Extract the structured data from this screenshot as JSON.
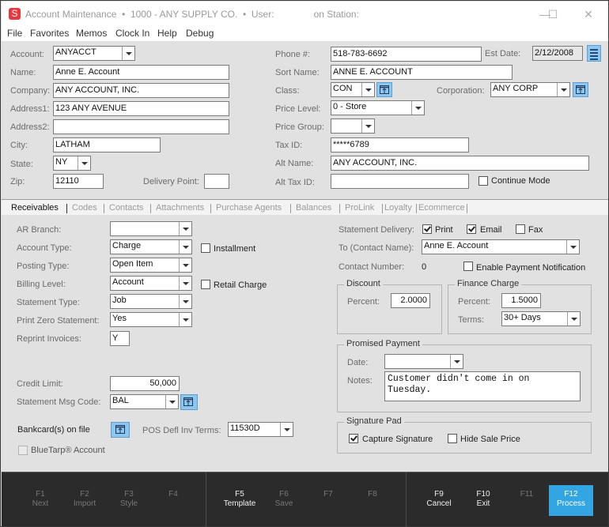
{
  "window": {
    "app_icon_letter": "S",
    "title": "Account Maintenance  •  1000 - ANY SUPPLY CO.  •  User:               on Station:",
    "controls": {
      "minimize": "—",
      "maximize": "☐",
      "close": "✕"
    }
  },
  "menu": [
    "File",
    "Favorites",
    "Memos",
    "Clock In",
    "Help",
    "Debug"
  ],
  "header": {
    "account_label": "Account:",
    "account_value": "ANYACCT",
    "name_label": "Name:",
    "name_value": "Anne E. Account",
    "company_label": "Company:",
    "company_value": "ANY ACCOUNT, INC.",
    "address1_label": "Address1:",
    "address1_value": "123 ANY AVENUE",
    "address2_label": "Address2:",
    "address2_value": "",
    "city_label": "City:",
    "city_value": "LATHAM",
    "state_label": "State:",
    "state_value": "NY",
    "zip_label": "Zip:",
    "zip_value": "12110",
    "delivery_point_label": "Delivery Point:",
    "delivery_point_value": "",
    "phone_label": "Phone #:",
    "phone_value": "518-783-6692",
    "est_date_label": "Est Date:",
    "est_date_value": "2/12/2008",
    "sort_name_label": "Sort Name:",
    "sort_name_value": "ANNE E. ACCOUNT",
    "class_label": "Class:",
    "class_value": "CON",
    "corporation_label": "Corporation:",
    "corporation_value": "ANY CORP",
    "price_level_label": "Price Level:",
    "price_level_value": "0 - Store",
    "price_group_label": "Price Group:",
    "price_group_value": "",
    "tax_id_label": "Tax ID:",
    "tax_id_value": "*****6789",
    "alt_name_label": "Alt  Name:",
    "alt_name_value": "ANY ACCOUNT, INC.",
    "alt_tax_id_label": "Alt Tax ID:",
    "alt_tax_id_value": "",
    "continue_mode_label": "Continue Mode",
    "continue_mode_checked": false
  },
  "tabs": [
    {
      "label": "Receivables",
      "active": true
    },
    {
      "label": "Codes",
      "active": false
    },
    {
      "label": "Contacts",
      "active": false
    },
    {
      "label": "Attachments",
      "active": false
    },
    {
      "label": "Purchase Agents",
      "active": false
    },
    {
      "label": "Balances",
      "active": false
    },
    {
      "label": "ProLink",
      "active": false
    },
    {
      "label": "Loyalty",
      "active": false
    },
    {
      "label": "Ecommerce",
      "active": false
    }
  ],
  "receivables": {
    "ar_branch_label": "AR Branch:",
    "ar_branch_value": "",
    "account_type_label": "Account Type:",
    "account_type_value": "Charge",
    "installment_label": "Installment",
    "installment_checked": false,
    "posting_type_label": "Posting Type:",
    "posting_type_value": "Open Item",
    "billing_level_label": "Billing Level:",
    "billing_level_value": "Account",
    "retail_charge_label": "Retail Charge",
    "retail_charge_checked": false,
    "statement_type_label": "Statement Type:",
    "statement_type_value": "Job",
    "print_zero_label": "Print Zero Statement:",
    "print_zero_value": "Yes",
    "reprint_invoices_label": "Reprint Invoices:",
    "reprint_invoices_value": "Y",
    "credit_limit_label": "Credit Limit:",
    "credit_limit_value": "50,000",
    "statement_msg_label": "Statement Msg Code:",
    "statement_msg_value": "BAL",
    "bankcards_label": "Bankcard(s) on file",
    "pos_terms_label": "POS Defl Inv Terms:",
    "pos_terms_value": "11530D",
    "bluetarp_label": "BlueTarp® Account",
    "bluetarp_checked": false,
    "statement_delivery_label": "Statement Delivery:",
    "print_label": "Print",
    "print_checked": true,
    "email_label": "Email",
    "email_checked": true,
    "fax_label": "Fax",
    "fax_checked": false,
    "to_contact_label": "To (Contact Name):",
    "to_contact_value": "Anne E. Account",
    "contact_number_label": "Contact Number:",
    "contact_number_value": "0",
    "enable_payment_label": "Enable Payment Notification",
    "enable_payment_checked": false,
    "discount": {
      "title": "Discount",
      "percent_label": "Percent:",
      "percent_value": "2.0000"
    },
    "finance_charge": {
      "title": "Finance Charge",
      "percent_label": "Percent:",
      "percent_value": "1.5000",
      "terms_label": "Terms:",
      "terms_value": "30+ Days"
    },
    "promised_payment": {
      "title": "Promised Payment",
      "date_label": "Date:",
      "date_value": "",
      "notes_label": "Notes:",
      "notes_value": "Customer didn't come in on Tuesday."
    },
    "signature_pad": {
      "title": "Signature Pad",
      "capture_label": "Capture Signature",
      "capture_checked": true,
      "hide_price_label": "Hide Sale Price",
      "hide_price_checked": false
    }
  },
  "footer": {
    "keys": [
      {
        "key": "F1",
        "label": "Next",
        "enabled": false
      },
      {
        "key": "F2",
        "label": "Import",
        "enabled": false
      },
      {
        "key": "F3",
        "label": "Style",
        "enabled": false
      },
      {
        "key": "F4",
        "label": "",
        "enabled": false
      },
      {
        "key": "F5",
        "label": "Template",
        "enabled": true
      },
      {
        "key": "F6",
        "label": "Save",
        "enabled": false
      },
      {
        "key": "F7",
        "label": "",
        "enabled": false
      },
      {
        "key": "F8",
        "label": "",
        "enabled": false
      },
      {
        "key": "F9",
        "label": "Cancel",
        "enabled": true
      },
      {
        "key": "F10",
        "label": "Exit",
        "enabled": true
      },
      {
        "key": "F11",
        "label": "",
        "enabled": false
      },
      {
        "key": "F12",
        "label": "Process",
        "enabled": true
      }
    ],
    "accent_color": "#33a5e3"
  }
}
